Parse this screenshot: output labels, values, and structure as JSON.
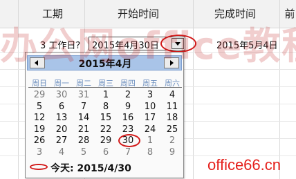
{
  "columns": {
    "period": "工期",
    "start_time": "开始时间",
    "finish_time": "完成时间",
    "truncated": "前"
  },
  "row": {
    "period_value": "3 工作日?",
    "start_value": "2015年4月30日",
    "finish_value": "2015年5月4日"
  },
  "calendar": {
    "month_label": "2015年4月",
    "weekdays": [
      "周日",
      "周一",
      "周二",
      "周三",
      "周四",
      "周五",
      "周六"
    ],
    "weeks": [
      [
        "29",
        "30",
        "31",
        "1",
        "2",
        "3",
        "4"
      ],
      [
        "5",
        "6",
        "7",
        "8",
        "9",
        "10",
        "11"
      ],
      [
        "12",
        "13",
        "14",
        "15",
        "16",
        "17",
        "18"
      ],
      [
        "19",
        "20",
        "21",
        "22",
        "23",
        "24",
        "25"
      ],
      [
        "26",
        "27",
        "28",
        "29",
        "30",
        "1",
        "2"
      ],
      [
        "3",
        "4",
        "5",
        "6",
        "7",
        "8",
        "9"
      ]
    ],
    "today_text": "今天: 2015/4/30",
    "annotation_color": "#d21a1a"
  },
  "watermark": {
    "big": "办公网office教程网",
    "site": "office66.cn"
  }
}
